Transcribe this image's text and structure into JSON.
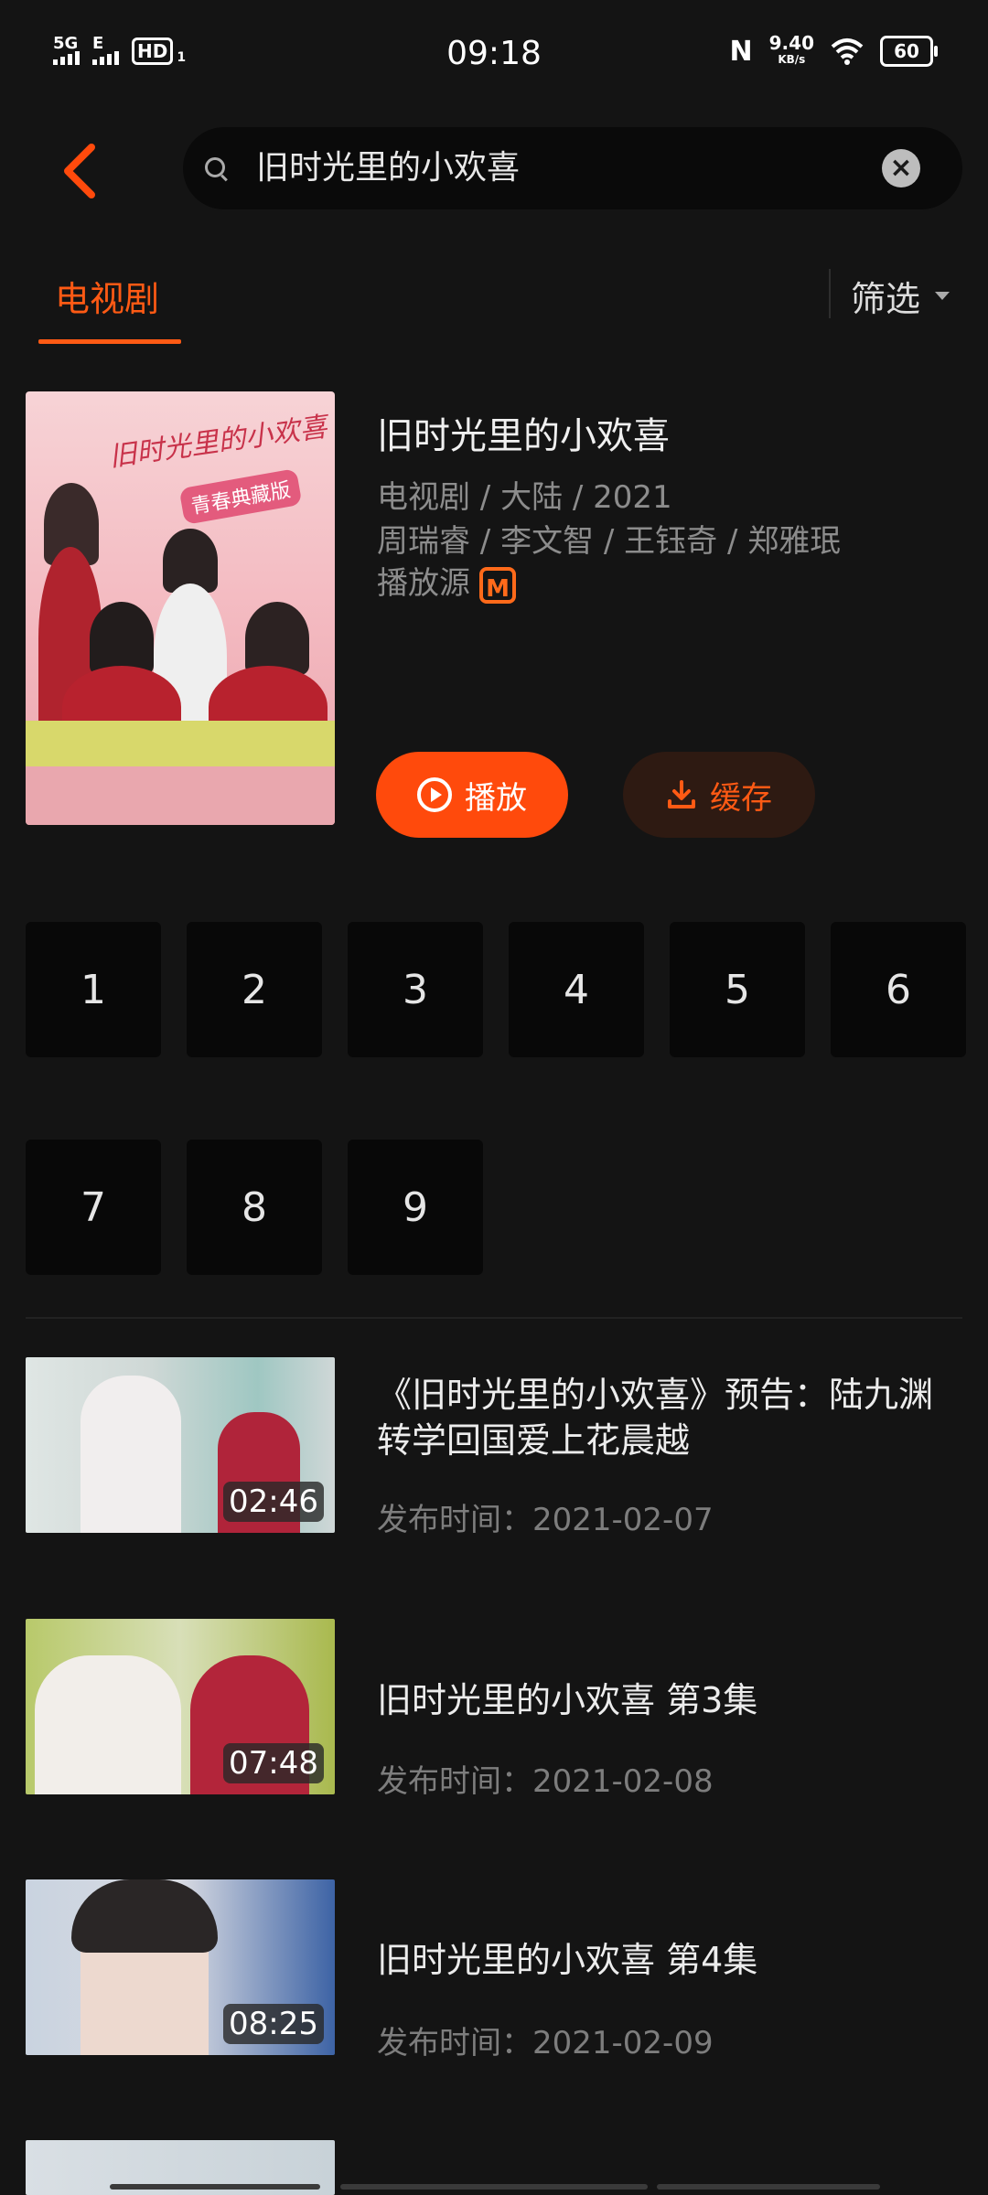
{
  "status_bar": {
    "net1": "5G",
    "net2": "E",
    "hd": "HD",
    "hd_sub": "1",
    "time": "09:18",
    "nfc": "N",
    "speed": "9.40",
    "speed_unit": "KB/s",
    "battery": "60"
  },
  "search": {
    "query": "旧时光里的小欢喜",
    "clear_icon": "close-icon"
  },
  "tabs": {
    "active": "电视剧",
    "filter": "筛选"
  },
  "show": {
    "title": "旧时光里的小欢喜",
    "meta_line1": "电视剧 / 大陆 / 2021",
    "meta_line2": "周瑞睿 / 李文智 / 王钰奇 / 郑雅珉",
    "source_label": "播放源",
    "source_logo": "M",
    "poster_title": "旧时光里的小欢喜",
    "poster_tag": "青春典藏版",
    "play_label": "播放",
    "cache_label": "缓存",
    "accent_color": "#ff4a0c"
  },
  "episodes": [
    "1",
    "2",
    "3",
    "4",
    "5",
    "6",
    "7",
    "8",
    "9"
  ],
  "videos": [
    {
      "title": "《旧时光里的小欢喜》预告：陆九渊转学回国爱上花晨越",
      "date": "发布时间：2021-02-07",
      "duration": "02:46"
    },
    {
      "title": "旧时光里的小欢喜 第3集",
      "date": "发布时间：2021-02-08",
      "duration": "07:48"
    },
    {
      "title": "旧时光里的小欢喜 第4集",
      "date": "发布时间：2021-02-09",
      "duration": "08:25"
    }
  ]
}
